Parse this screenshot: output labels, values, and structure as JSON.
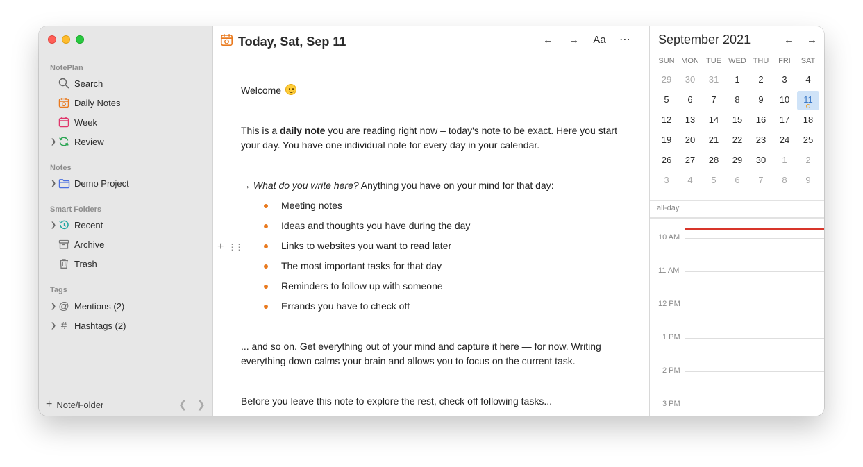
{
  "sidebar": {
    "sections": {
      "noteplan": "NotePlan",
      "notes": "Notes",
      "smart_folders": "Smart Folders",
      "tags": "Tags"
    },
    "items": {
      "search": "Search",
      "daily_notes": "Daily Notes",
      "week": "Week",
      "review": "Review",
      "demo_project": "Demo Project",
      "recent": "Recent",
      "archive": "Archive",
      "trash": "Trash",
      "mentions": "Mentions (2)",
      "hashtags": "Hashtags (2)"
    },
    "bottom": {
      "new_label": "Note/Folder"
    }
  },
  "editor": {
    "title": "Today, Sat, Sep 11",
    "font_button": "Aa",
    "paragraphs": {
      "welcome": "Welcome",
      "intro_pre": "This is a ",
      "intro_bold": "daily note",
      "intro_post": " you are reading right now – today's note to be exact. Here you start your day. You have one individual note for every day in your calendar.",
      "what_arrow": "→ ",
      "what_italic": "What do you write here?",
      "what_rest": " Anything you have on your mind for that day:",
      "so_on": "... and so on. Get everything out of your mind and capture it here — for now. Writing everything down calms your brain and allows you to focus on the current task.",
      "before": "Before you leave this note to explore the rest, check off following tasks..."
    },
    "bullets": [
      "Meeting notes",
      "Ideas and thoughts you have during the day",
      "Links to websites you want to read later",
      "The most important tasks for that day",
      "Reminders to follow up with someone",
      "Errands you have to check off"
    ]
  },
  "calendar": {
    "month_label": "September 2021",
    "weekdays": [
      "SUN",
      "MON",
      "TUE",
      "WED",
      "THU",
      "FRI",
      "SAT"
    ],
    "weeks": [
      [
        "29",
        "30",
        "31",
        "1",
        "2",
        "3",
        "4"
      ],
      [
        "5",
        "6",
        "7",
        "8",
        "9",
        "10",
        "11"
      ],
      [
        "12",
        "13",
        "14",
        "15",
        "16",
        "17",
        "18"
      ],
      [
        "19",
        "20",
        "21",
        "22",
        "23",
        "24",
        "25"
      ],
      [
        "26",
        "27",
        "28",
        "29",
        "30",
        "1",
        "2"
      ],
      [
        "3",
        "4",
        "5",
        "6",
        "7",
        "8",
        "9"
      ]
    ],
    "selected_day": "11",
    "all_day_label": "all-day",
    "hours": [
      "10 AM",
      "11 AM",
      "12 PM",
      "1 PM",
      "2 PM",
      "3 PM"
    ],
    "colors": {
      "today_bg": "#cfe3f8",
      "now_line": "#d8352a",
      "accent": "#e97a1f"
    }
  }
}
